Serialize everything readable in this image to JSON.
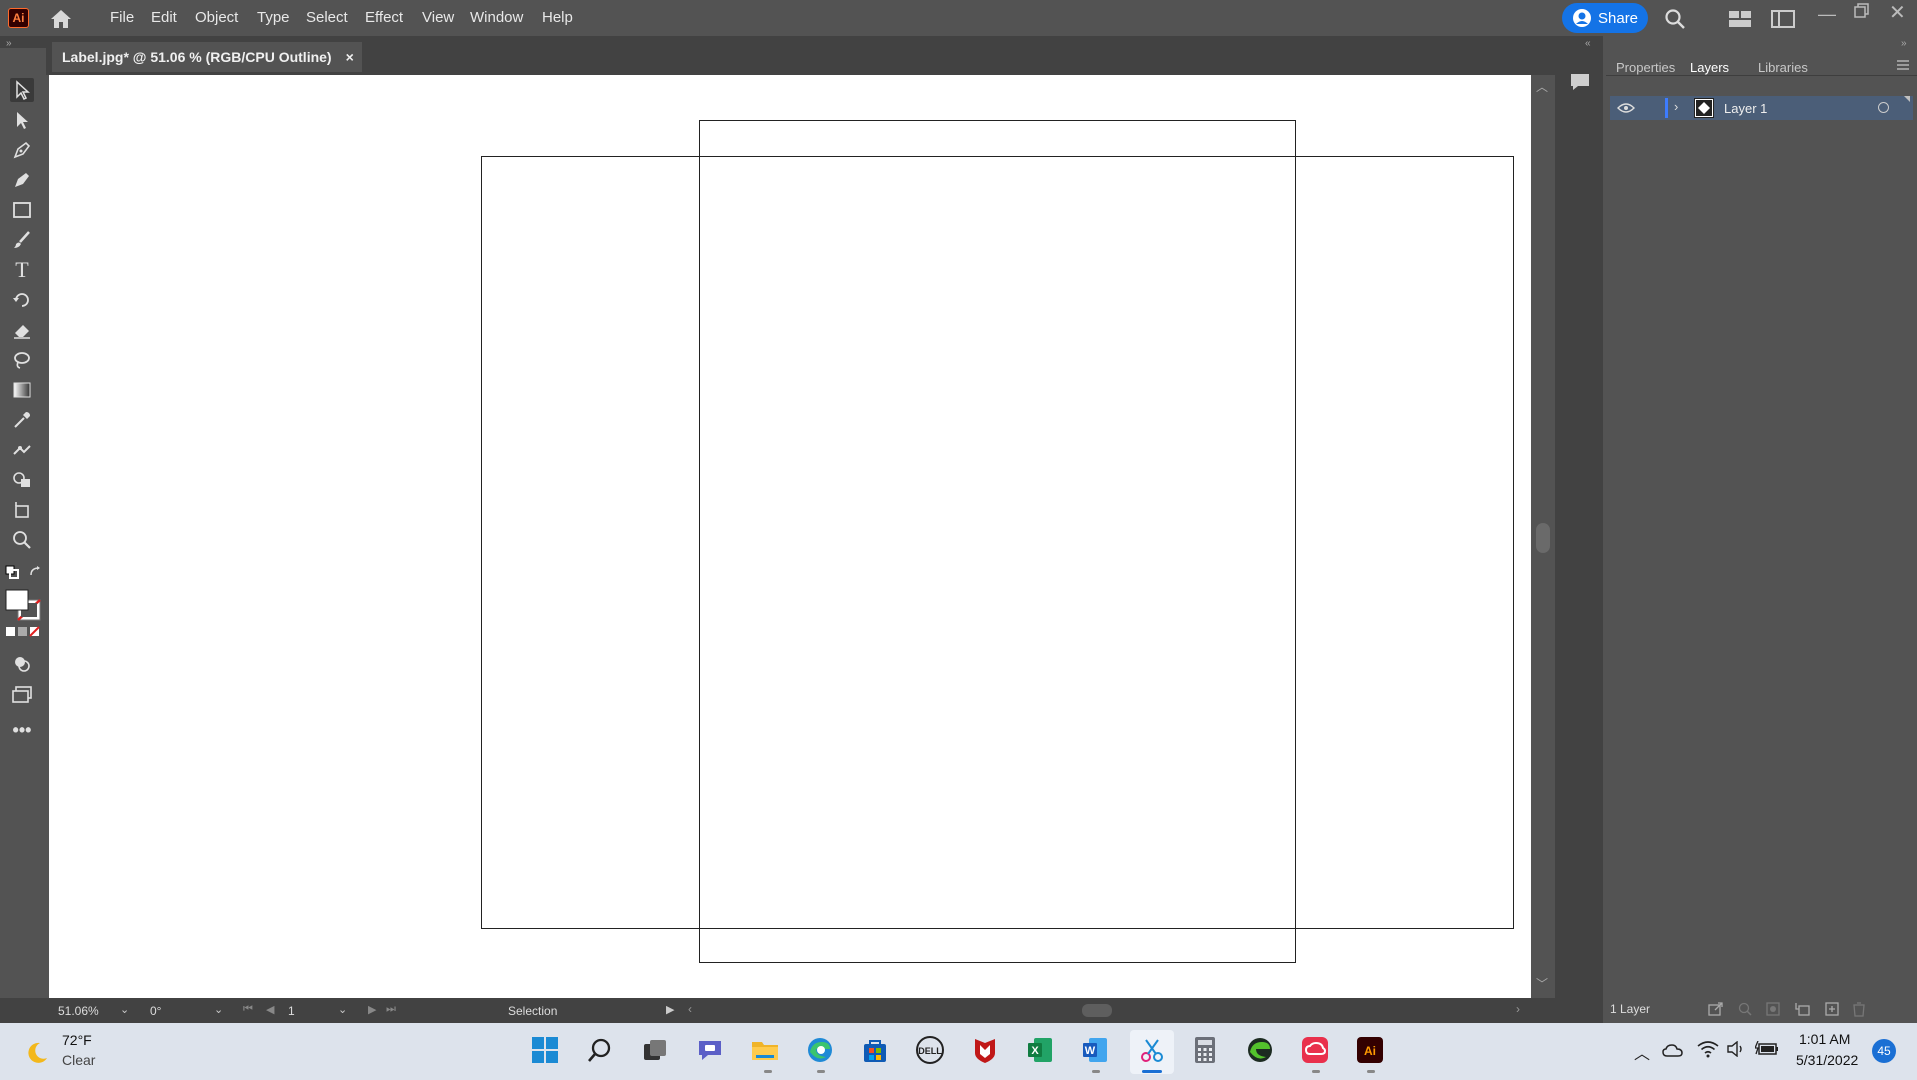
{
  "app": {
    "logo": "Ai"
  },
  "menu": [
    "File",
    "Edit",
    "Object",
    "Type",
    "Select",
    "Effect",
    "View",
    "Window",
    "Help"
  ],
  "share": {
    "label": "Share"
  },
  "document": {
    "tab_title": "Label.jpg* @ 51.06 % (RGB/CPU Outline)",
    "close": "×"
  },
  "status_bar": {
    "zoom": "51.06%",
    "rotation": "0°",
    "artboard": "1",
    "tool": "Selection"
  },
  "panels": {
    "tabs": [
      "Properties",
      "Layers",
      "Libraries"
    ],
    "active": "Layers"
  },
  "layers": [
    {
      "name": "Layer 1",
      "visible": true
    }
  ],
  "layers_footer": {
    "count": "1 Layer"
  },
  "taskbar": {
    "weather": {
      "temp": "72°F",
      "condition": "Clear"
    },
    "clock": {
      "time": "1:01 AM",
      "date": "5/31/2022"
    },
    "notifications": "45",
    "apps": [
      "start-icon",
      "search-icon",
      "task-view-icon",
      "chat-icon",
      "file-explorer-icon",
      "edge-icon",
      "store-icon",
      "dell-icon",
      "mcafee-icon",
      "excel-icon",
      "word-icon",
      "snipping-tool-icon",
      "calculator-icon",
      "edge-dev-icon",
      "creative-cloud-icon",
      "illustrator-icon"
    ]
  },
  "colors": {
    "accent": "#1473e6",
    "ui_bg": "#535353",
    "panel_dark": "#424242",
    "layer_highlight": "#4b5e78"
  }
}
